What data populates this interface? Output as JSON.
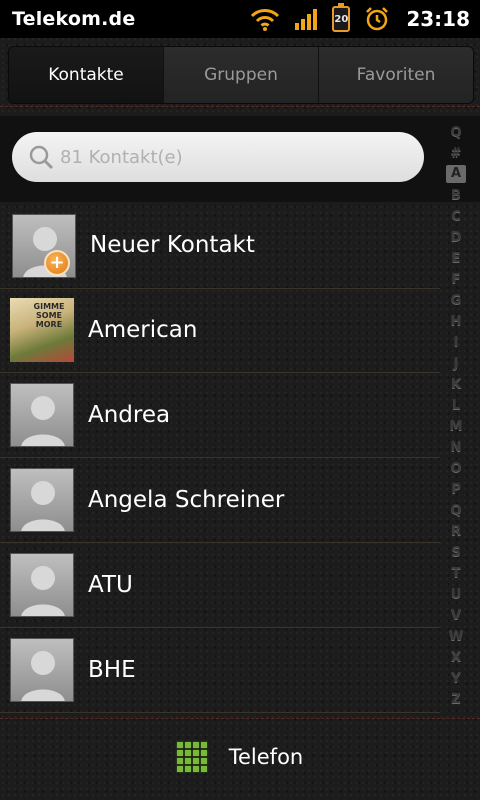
{
  "status": {
    "carrier": "Telekom.de",
    "battery_level": "20",
    "time": "23:18",
    "icons": [
      "wifi-icon",
      "signal-icon",
      "battery-icon",
      "alarm-icon"
    ]
  },
  "tabs": [
    {
      "label": "Kontakte",
      "active": true
    },
    {
      "label": "Gruppen",
      "active": false
    },
    {
      "label": "Favoriten",
      "active": false
    }
  ],
  "search": {
    "placeholder": "81 Kontakt(e)"
  },
  "contacts": {
    "new_contact": "Neuer Kontakt",
    "items": [
      {
        "name": "American",
        "avatar": "album-art"
      },
      {
        "name": "Andrea",
        "avatar": "default-avatar"
      },
      {
        "name": "Angela Schreiner",
        "avatar": "default-avatar"
      },
      {
        "name": "ATU",
        "avatar": "default-avatar"
      },
      {
        "name": "BHE",
        "avatar": "default-avatar"
      }
    ],
    "album_text": "GIMME SOME MORE"
  },
  "alphabet": {
    "items": [
      "Q",
      "#",
      "A",
      "B",
      "C",
      "D",
      "E",
      "F",
      "G",
      "H",
      "I",
      "J",
      "K",
      "L",
      "M",
      "N",
      "O",
      "P",
      "Q",
      "R",
      "S",
      "T",
      "U",
      "V",
      "W",
      "X",
      "Y",
      "Z"
    ],
    "selected": "A"
  },
  "bottom": {
    "label": "Telefon",
    "icon": "dialpad-grid-icon",
    "icon_color": "#7ab83a"
  },
  "colors": {
    "battery": "#e89a2b",
    "signal": "#f2a516",
    "wifi": "#f2a516",
    "plus_badge": "#f08a1a"
  }
}
